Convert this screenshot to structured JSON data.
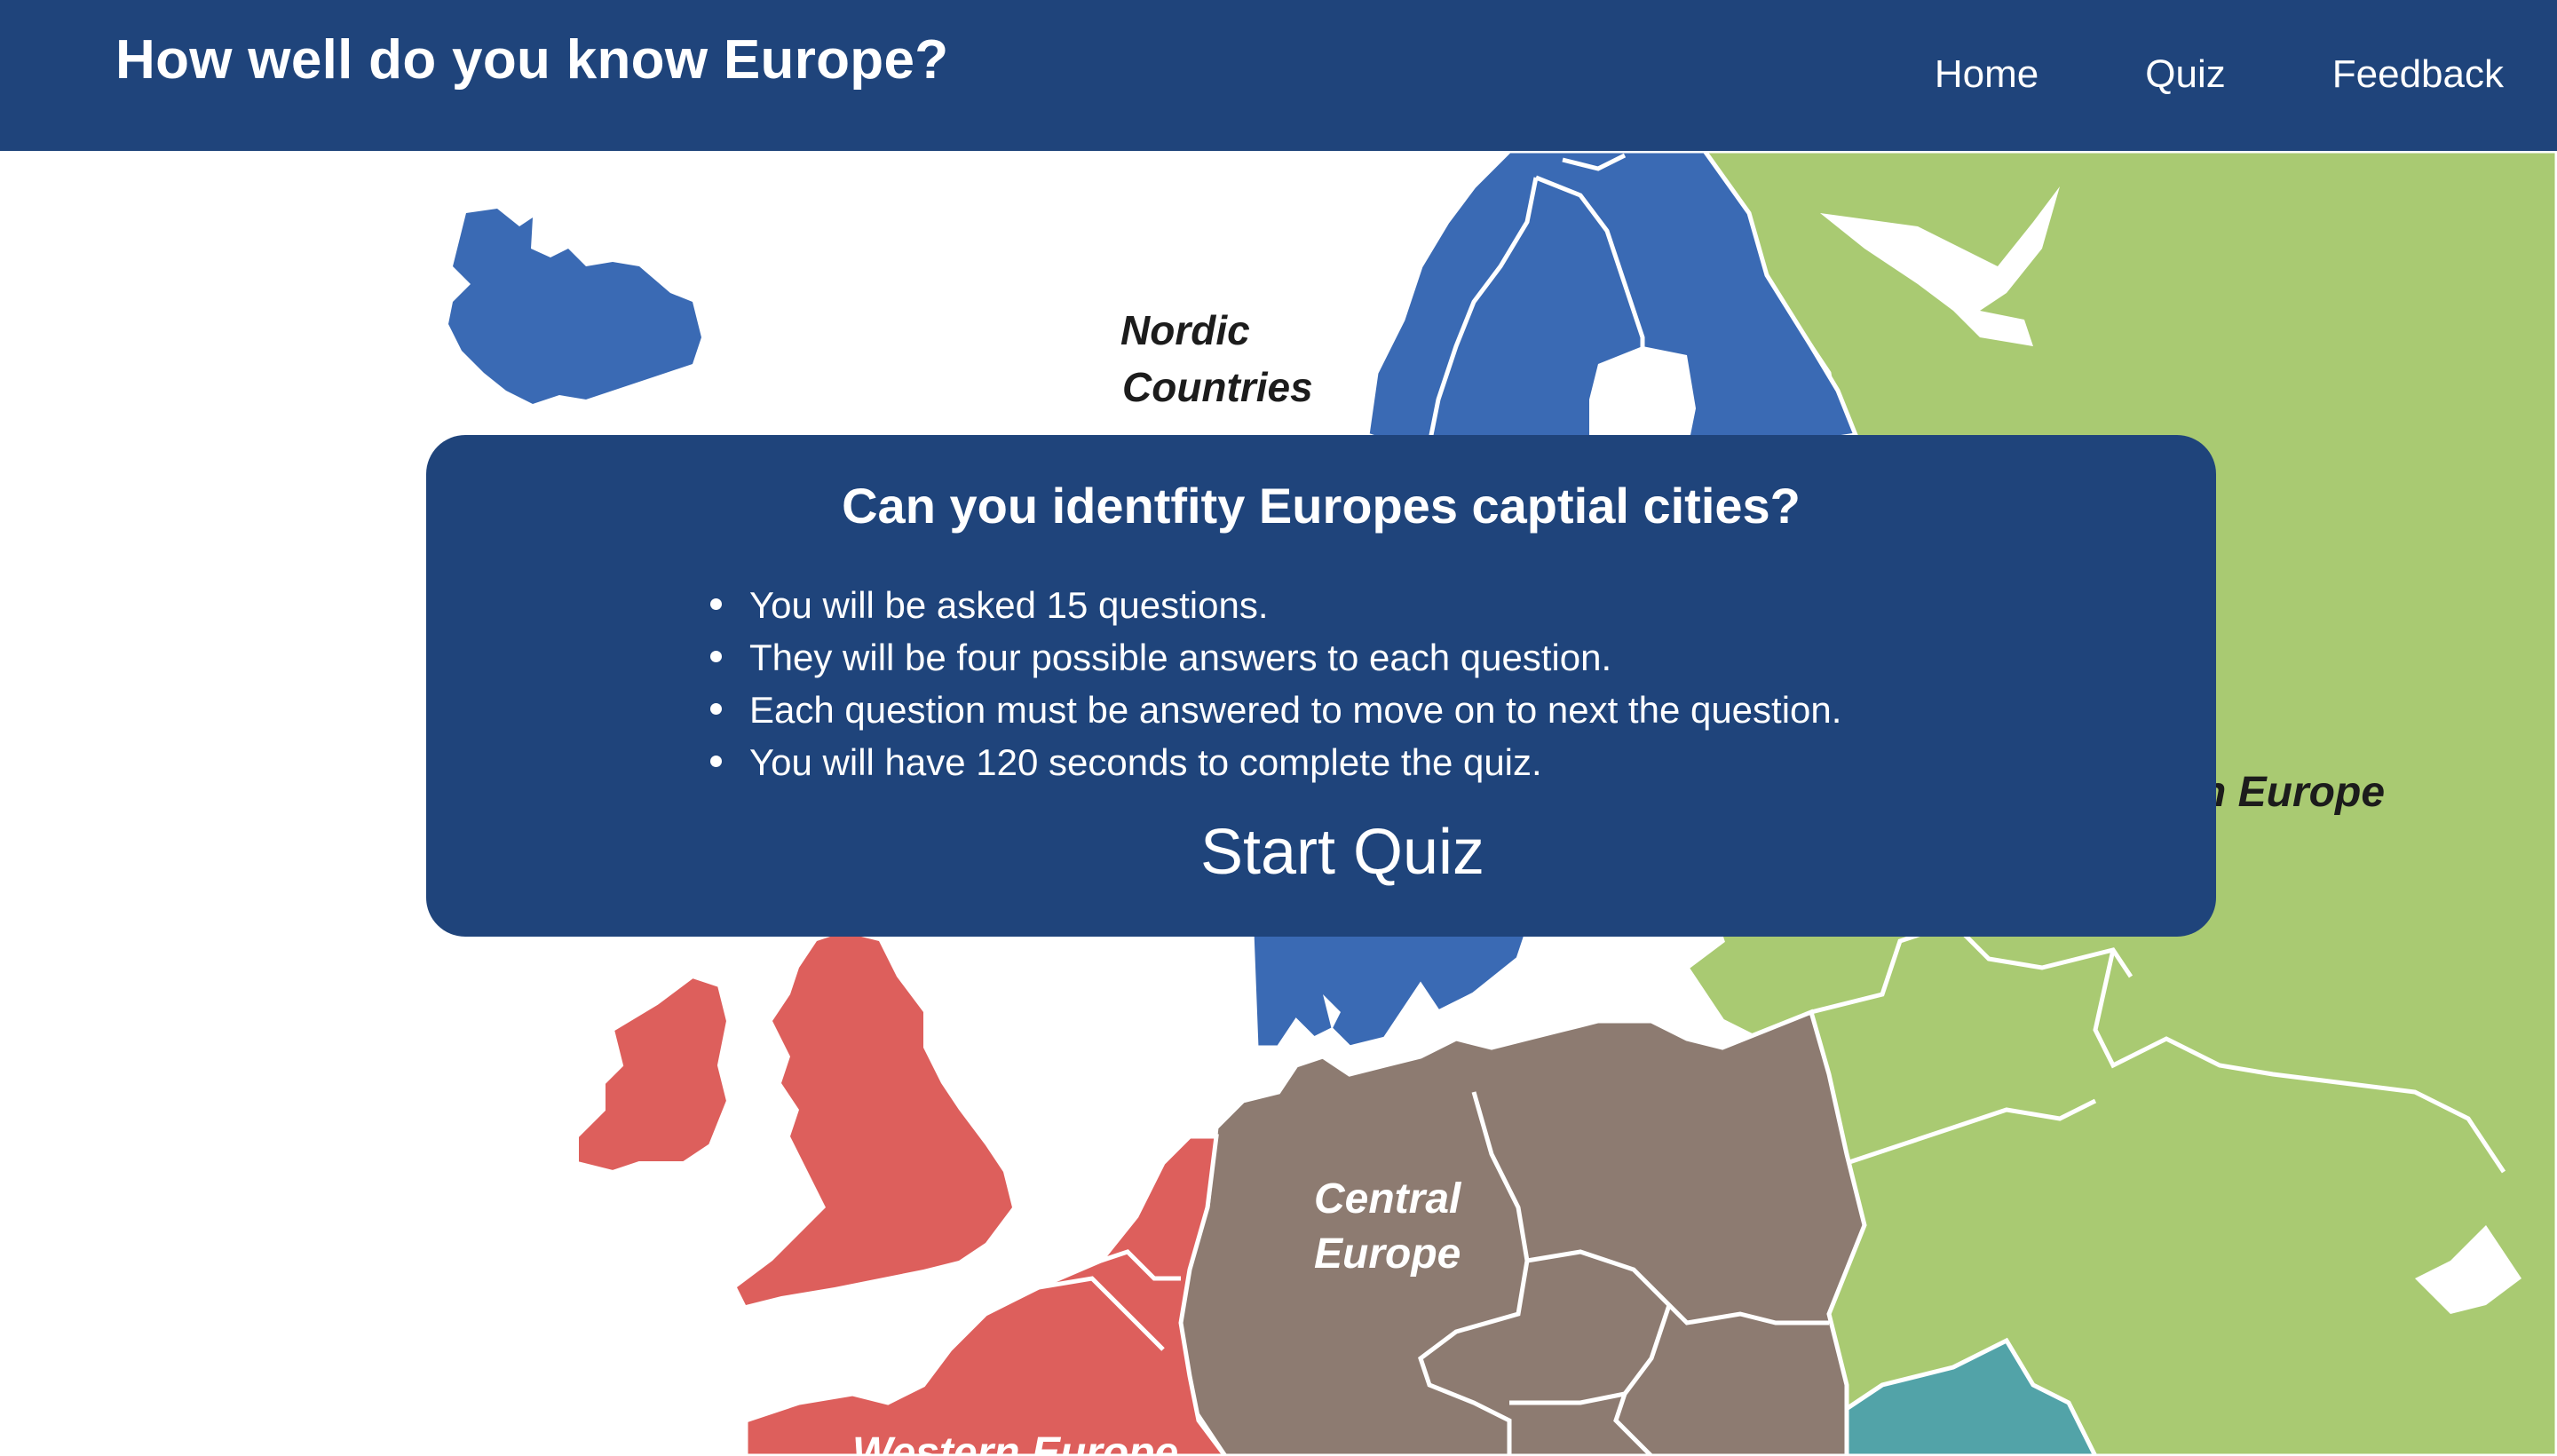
{
  "header": {
    "title": "How well do you know Europe?",
    "nav": {
      "home": "Home",
      "quiz": "Quiz",
      "feedback": "Feedback"
    }
  },
  "map": {
    "labels": {
      "nordic_line1": "Nordic",
      "nordic_line2": "Countries",
      "eastern_partial": "n Europe",
      "central_line1": "Central",
      "central_line2": "Europe",
      "western_partial": "Western Europe"
    },
    "colors": {
      "nordic": "#3a6ab4",
      "eastern": "#a9ca72",
      "central": "#8d7b71",
      "western": "#dd5f5c",
      "southeastern": "#52a3a8",
      "background": "#ffffff"
    }
  },
  "quiz": {
    "heading": "Can you identfity Europes captial cities?",
    "rules": [
      "You will be asked 15 questions.",
      "They will be four possible answers to each question.",
      "Each question must be answered to move on to next the question.",
      "You will have 120 seconds to complete the quiz."
    ],
    "start_label": "Start Quiz"
  },
  "colors": {
    "header_bg": "#1f447b",
    "card_bg": "#1f447b",
    "text": "#ffffff"
  }
}
